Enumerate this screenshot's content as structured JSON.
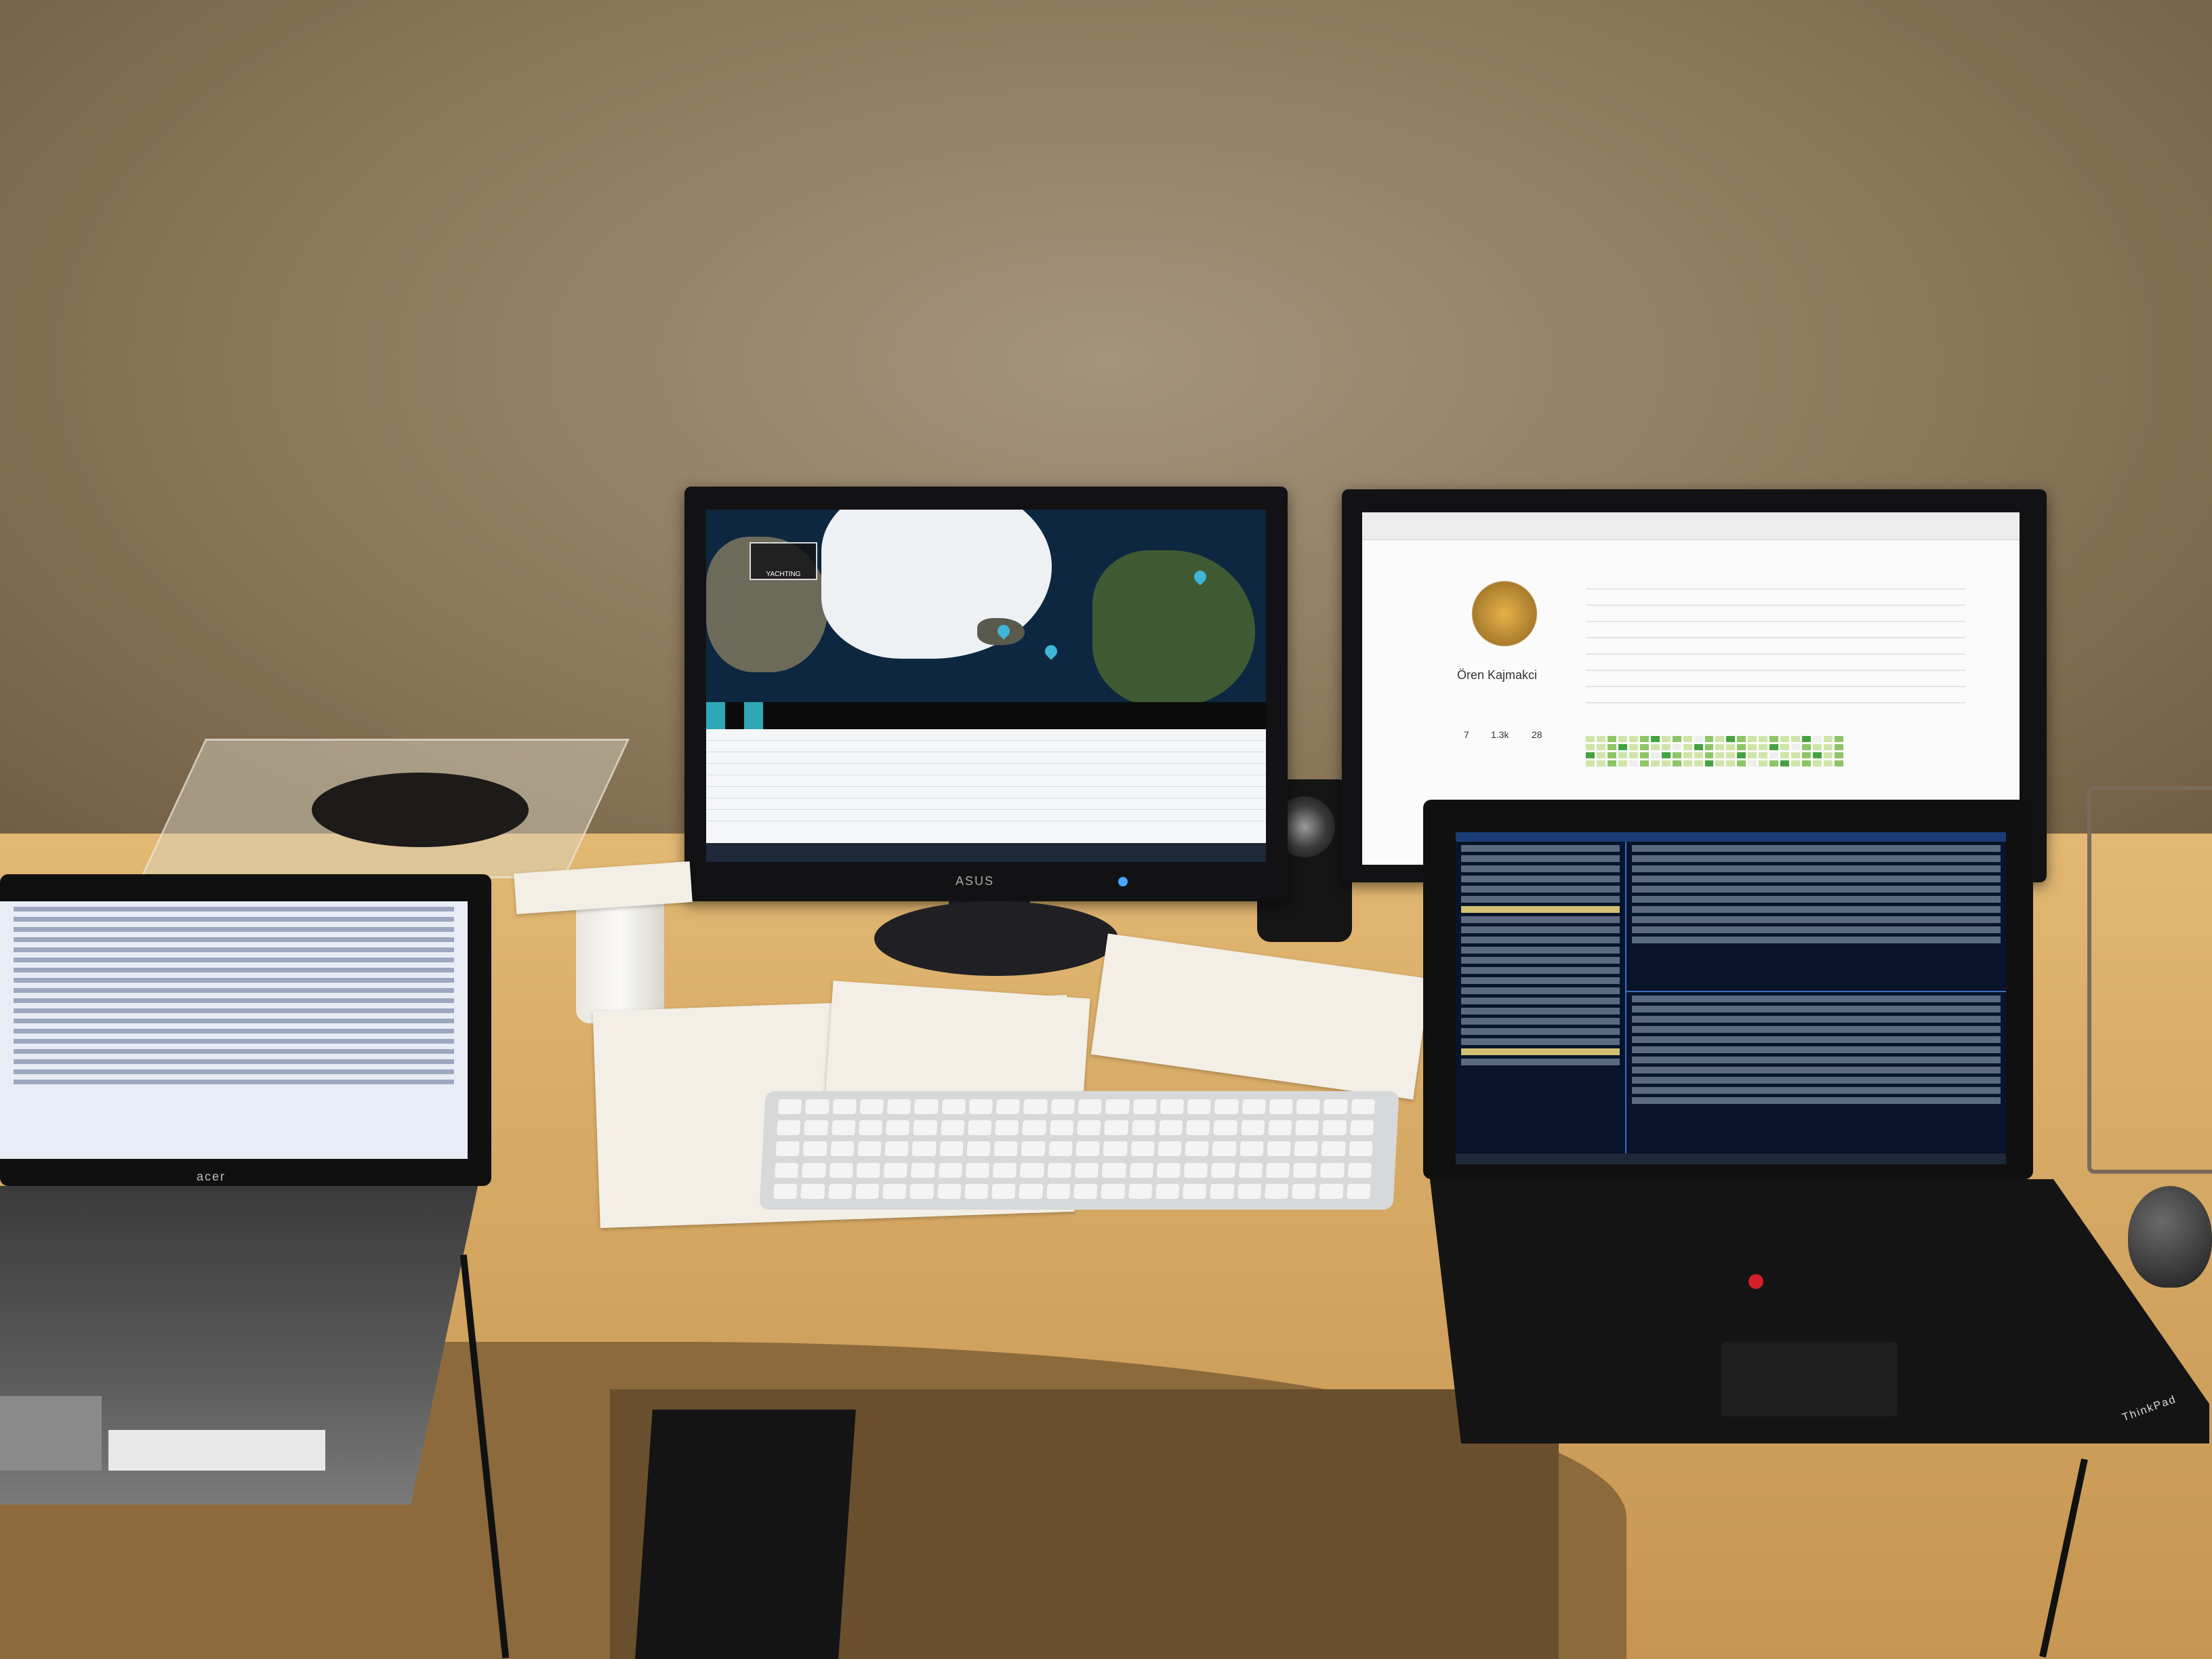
{
  "scene": {
    "description_items": [
      "wall",
      "desk",
      "monitor-asus",
      "monitor-right",
      "laptop-acer",
      "laptop-thinkpad",
      "keyboard",
      "papers",
      "cup",
      "speaker",
      "paper-tray",
      "wire-rack",
      "mouse"
    ]
  },
  "monitor_left": {
    "brand": "ASUS",
    "map_badge": "YACHTING",
    "tabs": [
      "",
      "",
      ""
    ],
    "table_rows": 8
  },
  "monitor_right": {
    "profile_name": "Ören Kajmakci",
    "stats": [
      "7",
      "1.3k",
      "28"
    ]
  },
  "laptop_left": {
    "brand": "acer"
  },
  "laptop_right": {
    "brand": "ThinkPad"
  },
  "colors": {
    "wall": "#8a7658",
    "desk": "#d6a964",
    "map_accent": "#2ea7b5",
    "terminal_bg": "#08142a"
  }
}
